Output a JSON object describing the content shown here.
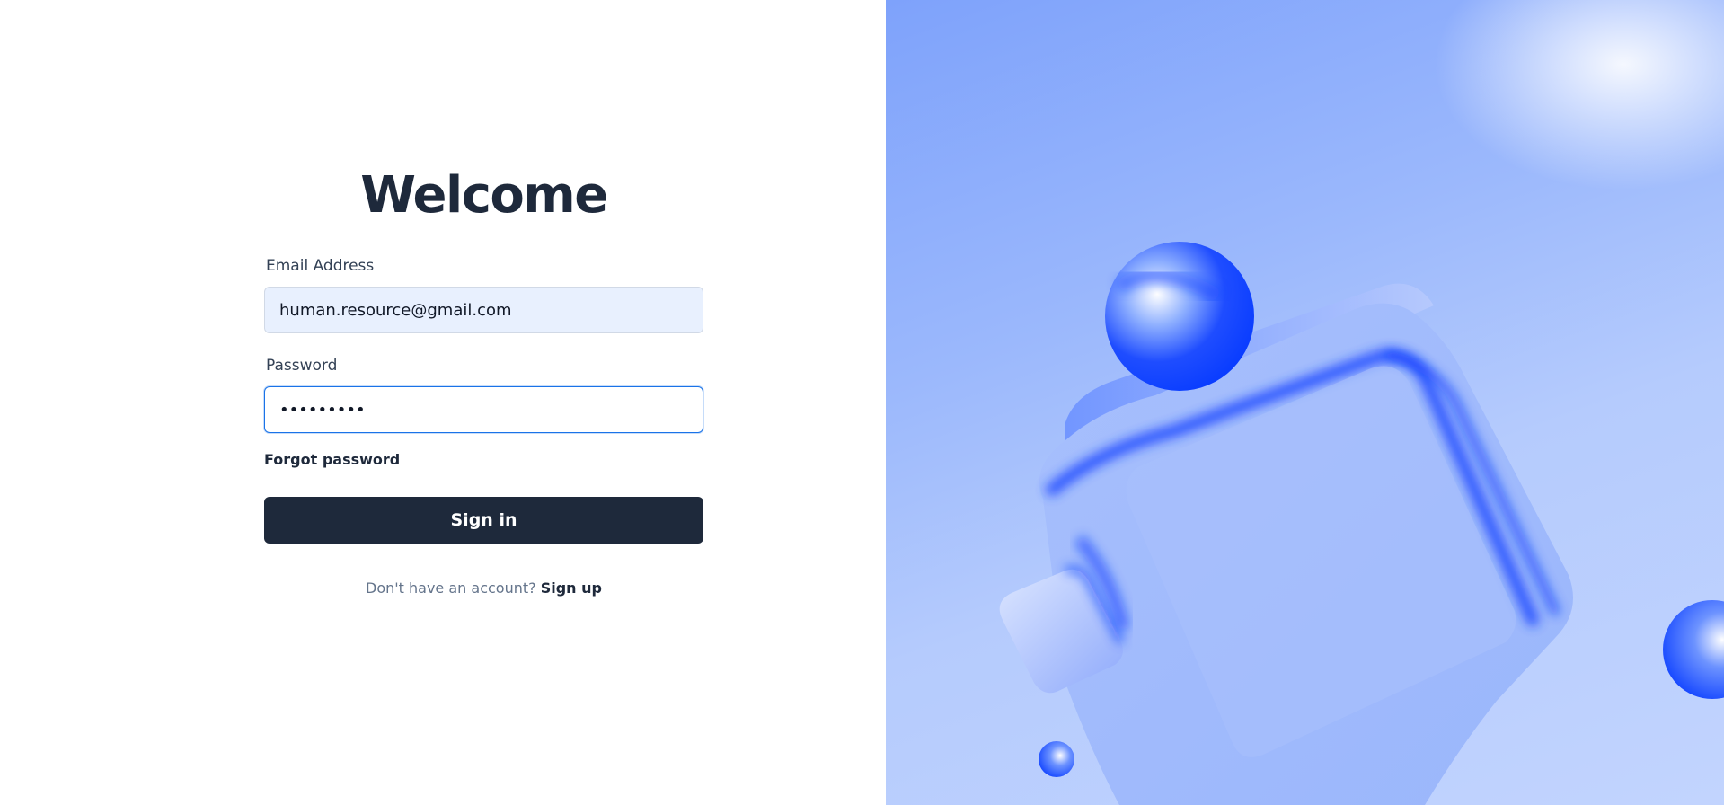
{
  "welcome": {
    "title": "Welcome"
  },
  "form": {
    "email_label": "Email Address",
    "email_value": "human.resource@gmail.com",
    "password_label": "Password",
    "password_value": "•••••••••",
    "forgot_label": "Forgot password",
    "signin_label": "Sign in",
    "signup_prompt": "Don't have an account?",
    "signup_label": "Sign up"
  },
  "illustration": {
    "name": "abstract-blue-3d-shapes",
    "colors": {
      "accent": "#0a3dff",
      "light": "#c2d4fe",
      "button": "#1e293b"
    }
  }
}
